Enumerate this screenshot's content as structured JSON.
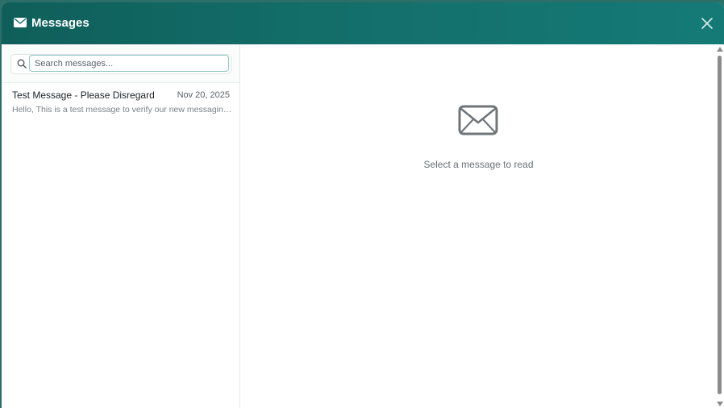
{
  "header": {
    "title": "Messages",
    "icon": "envelope-icon",
    "close_icon": "close-icon"
  },
  "search": {
    "placeholder": "Search messages...",
    "value": ""
  },
  "messages": [
    {
      "subject": "Test Message - Please Disregard",
      "date": "Nov 20, 2025",
      "preview": "Hello, This is a test message to verify our new messaging system is working correctly."
    }
  ],
  "reader": {
    "empty_icon": "envelope-icon",
    "empty_text": "Select a message to read"
  },
  "colors": {
    "header_bg": "#136e6a",
    "accent": "#8fc7c0"
  }
}
